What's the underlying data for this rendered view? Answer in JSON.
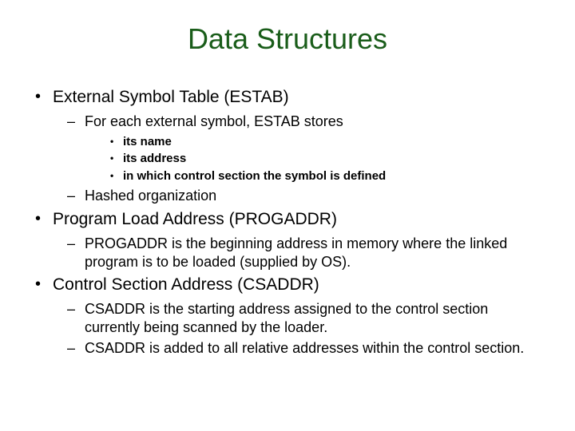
{
  "title": "Data Structures",
  "items": [
    {
      "label": "External Symbol Table (ESTAB)",
      "sub": [
        {
          "label": "For each external symbol, ESTAB stores",
          "sub": [
            {
              "label": "its name"
            },
            {
              "label": "its address"
            },
            {
              "label": "in which control section the symbol is defined"
            }
          ]
        },
        {
          "label": "Hashed organization"
        }
      ]
    },
    {
      "label": "Program Load Address (PROGADDR)",
      "sub": [
        {
          "label": "PROGADDR is the beginning address in memory where the linked program is to be loaded (supplied by OS)."
        }
      ]
    },
    {
      "label": "Control Section Address (CSADDR)",
      "sub": [
        {
          "label": "CSADDR is the starting address assigned to the control section currently being scanned by the loader."
        },
        {
          "label": "CSADDR is added to all relative addresses within the control section."
        }
      ]
    }
  ]
}
